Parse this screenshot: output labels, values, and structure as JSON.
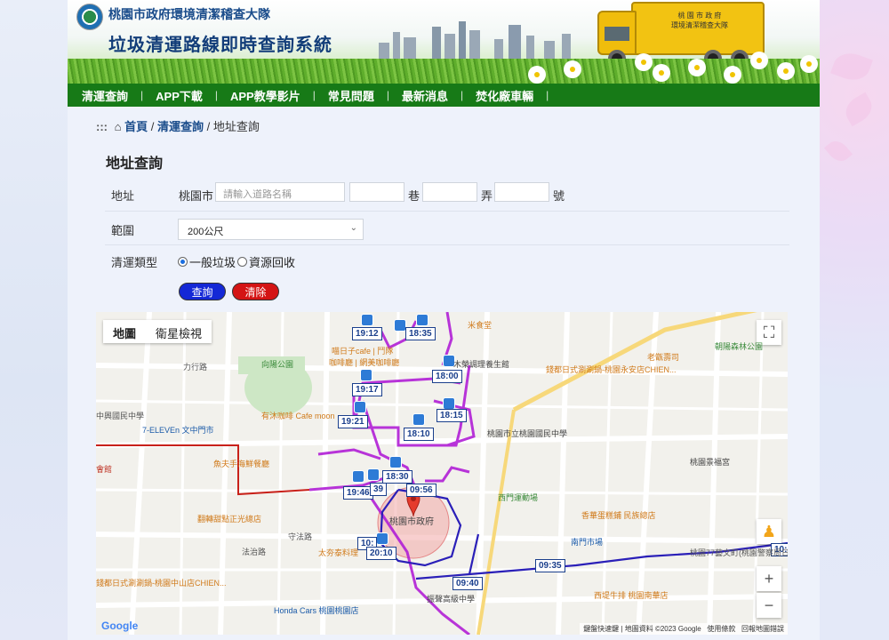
{
  "header": {
    "bureau": "桃園市政府環境清潔稽查大隊",
    "system_title": "垃圾清運路線即時查詢系統",
    "truck_text": "桃 園 市 政 府\n環境清潔稽查大隊"
  },
  "nav": [
    "清運查詢",
    "APP下載",
    "APP教學影片",
    "常見問題",
    "最新消息",
    "焚化廠車輛"
  ],
  "breadcrumb": {
    "home": "首頁",
    "level1": "清運查詢",
    "current": "地址查詢"
  },
  "form": {
    "title": "地址查詢",
    "address_label": "地址",
    "city": "桃園市",
    "road_placeholder": "請輸入道路名稱",
    "lane_label": "巷",
    "alley_label": "弄",
    "number_label": "號",
    "range_label": "範圍",
    "range_value": "200公尺",
    "type_label": "清運類型",
    "type_options": [
      "一般垃圾",
      "資源回收"
    ],
    "type_selected": "一般垃圾",
    "query_button": "查詢",
    "clear_button": "清除"
  },
  "map": {
    "type_tabs": [
      "地圖",
      "衛星檢視"
    ],
    "active_tab": "地圖",
    "zoom_in": "+",
    "zoom_out": "−",
    "center_label": "桃園市政府",
    "time_labels": [
      "19:12",
      "18:35",
      "18:00",
      "19:17",
      "18:15",
      "19:21",
      "18:10",
      "18:30",
      "19:46",
      "39",
      "09:56",
      "10:",
      "20:10",
      "09:35",
      "09:40",
      "10:4"
    ],
    "places": [
      "米食堂",
      "喵日子cafe | 鬥隊",
      "咖啡廳 | 網美咖啡廳",
      "木榮調理養生館",
      "向陽公園",
      "有沐咖啡 Cafe moon",
      "文中門市",
      "7-ELEVEn 文中門市",
      "中興國民中學",
      "魚夫手海鮮餐廳",
      "翻轉甜點正光總店",
      "太夯泰料理",
      "錢都日式涮涮鍋-桃園永安店CHIEN...",
      "錢都日式涮涮鍋-桃園中山店CHIEN...",
      "老甑壽司",
      "朝陽森林公園",
      "桃園市立桃園國民中學",
      "西門運動場",
      "香華蛋糕鋪 民族總店",
      "南門市場",
      "桃園77藝文町(桃園警察局日式宿舍群)",
      "西堤牛排 桃園南華店",
      "Honda Cars 桃園桃園店",
      "振聲高級中學",
      "桃園景福宮",
      "會館",
      "力行路",
      "守法路",
      "法治路"
    ],
    "attribution": [
      "鍵盤快速鍵",
      "地圖資料 ©2023 Google",
      "使用條款",
      "回報地圖錯誤"
    ],
    "google": "Google"
  },
  "colors": {
    "nav": "#177a17",
    "query": "#1428d6",
    "clear": "#d41414",
    "route_magenta": "#b11fd6",
    "route_blue": "#2a1fb8",
    "route_red": "#c8211a"
  }
}
